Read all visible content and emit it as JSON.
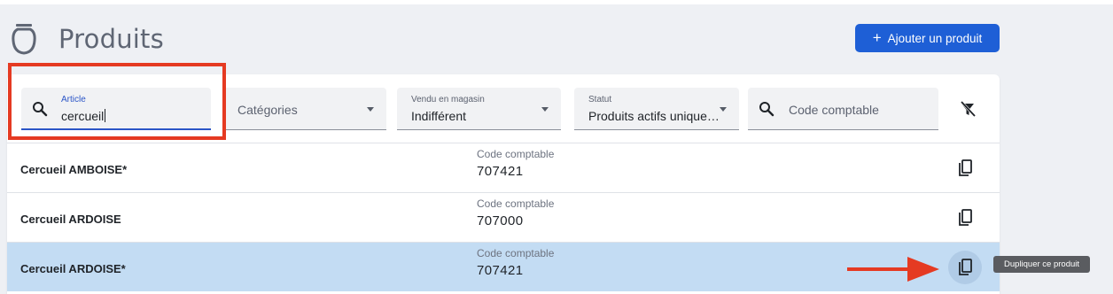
{
  "header": {
    "title": "Produits",
    "add_button_label": "Ajouter un produit",
    "add_button_icon": "+"
  },
  "filters": {
    "article": {
      "label": "Article",
      "value": "cercueil"
    },
    "categories": {
      "placeholder": "Catégories"
    },
    "vendu": {
      "label": "Vendu en magasin",
      "value": "Indifférent"
    },
    "statut": {
      "label": "Statut",
      "value": "Produits actifs unique…"
    },
    "code": {
      "placeholder": "Code comptable"
    }
  },
  "products": [
    {
      "name": "Cercueil AMBOISE*",
      "code_label": "Code comptable",
      "code": "707421",
      "selected": false
    },
    {
      "name": "Cercueil ARDOISE",
      "code_label": "Code comptable",
      "code": "707000",
      "selected": false
    },
    {
      "name": "Cercueil ARDOISE*",
      "code_label": "Code comptable",
      "code": "707421",
      "selected": true
    }
  ],
  "tooltip": "Dupliquer ce produit",
  "colors": {
    "primary": "#1e5fd6",
    "selected_row": "#c3dcf3",
    "annotation_red": "#e53a22",
    "background": "#eef0f4"
  },
  "icons": {
    "logo": "urn-logo-icon",
    "search": "search-icon",
    "clear_filters": "filter-off-icon",
    "duplicate": "copy-icon"
  }
}
